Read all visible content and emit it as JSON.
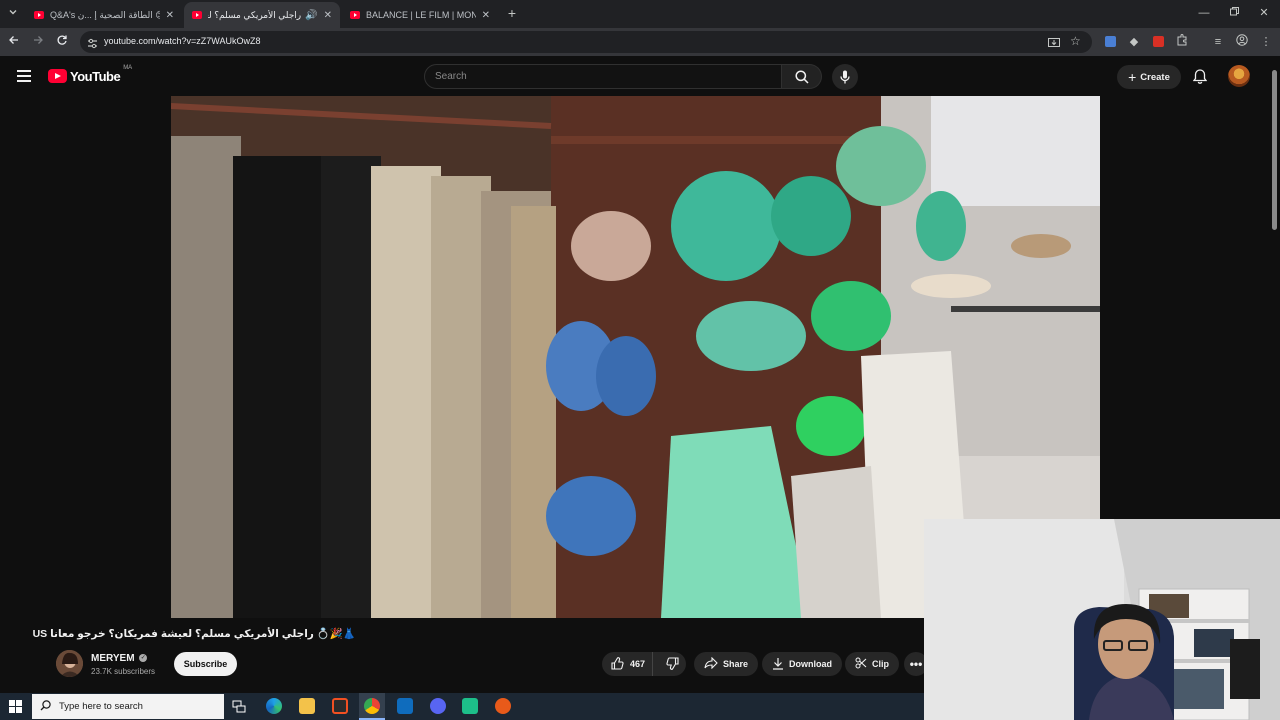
{
  "browser": {
    "tabs": [
      {
        "title": "Q&A's إ😂😊 الطاقة الصحية إ ...ن",
        "active": false
      },
      {
        "title": "راجلي الأمريكي مسلم؟ لعيشة",
        "active": true
      },
      {
        "title": "BALANCE | LE FILM | MON TOU",
        "active": false
      }
    ],
    "url": "youtube.com/watch?v=zZ7WAUkOwZ8"
  },
  "youtube": {
    "logo_text": "YouTube",
    "country_code": "MA",
    "search_placeholder": "Search",
    "create_label": "Create"
  },
  "video": {
    "title": "👗🎉💍 راجلي الأمريكي مسلم؟ لعيشة فمريكان؟ خرجو معانا US",
    "channel_name": "MERYEM",
    "verified": true,
    "subscribers": "23.7K subscribers",
    "subscribe_label": "Subscribe",
    "likes": "467",
    "share_label": "Share",
    "download_label": "Download",
    "clip_label": "Clip"
  },
  "taskbar": {
    "search_placeholder": "Type here to search"
  },
  "colors": {
    "youtube_red": "#ff0033",
    "background": "#0f0f0f",
    "pill": "#272727"
  }
}
